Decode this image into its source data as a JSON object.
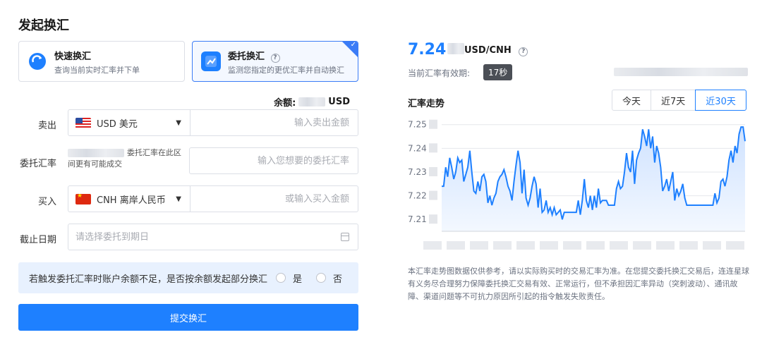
{
  "page": {
    "title": "发起换汇"
  },
  "modes": [
    {
      "title": "快速换汇",
      "desc": "查询当前实时汇率并下单",
      "icon": "quick-exchange-icon"
    },
    {
      "title": "委托换汇",
      "desc": "监测您指定的更优汇率并自动换汇",
      "icon": "entrusted-exchange-icon"
    }
  ],
  "balance": {
    "label": "余额:",
    "currency": "USD"
  },
  "form": {
    "sell": {
      "label": "卖出",
      "currency": "USD 美元",
      "placeholder": "输入卖出金额"
    },
    "rate": {
      "label": "委托汇率",
      "hint": "委托汇率在此区间更有可能成交",
      "placeholder": "输入您想要的委托汇率"
    },
    "buy": {
      "label": "买入",
      "currency": "CNH 离岸人民币",
      "placeholder": "或输入买入金额"
    },
    "deadline": {
      "label": "截止日期",
      "placeholder": "请选择委托到期日"
    },
    "partial": {
      "question": "若触发委托汇率时账户余额不足，是否按余额发起部分换汇",
      "yes": "是",
      "no": "否"
    },
    "submit": "提交换汇"
  },
  "quote": {
    "rate": "7.24",
    "pair": "USD/CNH",
    "valid_label": "当前汇率有效期:",
    "timer": "17秒"
  },
  "trend": {
    "title": "汇率走势",
    "tabs": [
      "今天",
      "近7天",
      "近30天"
    ],
    "active_tab": "近30天"
  },
  "chart_data": {
    "type": "area",
    "title": "汇率走势",
    "ylim": [
      7.205,
      7.252
    ],
    "yticks": [
      "7.25",
      "7.24",
      "7.23",
      "7.22",
      "7.21"
    ],
    "grid": true,
    "values": [
      7.224,
      7.224,
      7.232,
      7.228,
      7.236,
      7.232,
      7.227,
      7.23,
      7.236,
      7.234,
      7.235,
      7.226,
      7.229,
      7.232,
      7.239,
      7.23,
      7.222,
      7.221,
      7.226,
      7.222,
      7.228,
      7.229,
      7.226,
      7.217,
      7.22,
      7.216,
      7.219,
      7.221,
      7.226,
      7.228,
      7.229,
      7.231,
      7.228,
      7.224,
      7.222,
      7.218,
      7.226,
      7.233,
      7.239,
      7.234,
      7.221,
      7.231,
      7.219,
      7.216,
      7.219,
      7.224,
      7.228,
      7.225,
      7.215,
      7.223,
      7.213,
      7.214,
      7.218,
      7.213,
      7.215,
      7.212,
      7.215,
      7.212,
      7.213,
      7.214,
      7.21,
      7.213,
      7.213,
      7.213,
      7.213,
      7.213,
      7.213,
      7.213,
      7.218,
      7.212,
      7.218,
      7.227,
      7.218,
      7.215,
      7.22,
      7.214,
      7.22,
      7.215,
      7.223,
      7.217,
      7.218,
      7.218,
      7.218,
      7.216,
      7.216,
      7.216,
      7.216,
      7.223,
      7.226,
      7.223,
      7.224,
      7.23,
      7.238,
      7.232,
      7.23,
      7.239,
      7.225,
      7.235,
      7.238,
      7.24,
      7.248,
      7.245,
      7.241,
      7.248,
      7.24,
      7.245,
      7.234,
      7.241,
      7.238,
      7.232,
      7.222,
      7.224,
      7.227,
      7.222,
      7.226,
      7.23,
      7.218,
      7.223,
      7.22,
      7.222,
      7.225,
      7.219,
      7.216,
      7.216,
      7.216,
      7.216,
      7.216,
      7.216,
      7.216,
      7.216,
      7.216,
      7.216,
      7.216,
      7.216,
      7.216,
      7.216,
      7.221,
      7.217,
      7.219,
      7.226,
      7.227,
      7.224,
      7.228,
      7.235,
      7.239,
      7.234,
      7.241,
      7.238,
      7.246,
      7.249,
      7.249,
      7.243
    ],
    "colors": {
      "line": "#1e80ff",
      "fill_top": "#cfe2ff",
      "fill_bottom": "#f3f8ff"
    }
  },
  "disclaimer": "本汇率走势图数据仅供参考，请以实际购买时的交易汇率为准。在您提交委托换汇交易后，连连星球有义务尽合理努力保障委托换汇交易有效、正常运行，但不承担因汇率异动（突刺波动）、通讯故障、渠道问题等不可抗力原因所引起的指令触发失败责任。",
  "colors": {
    "accent": "#1e80ff",
    "tint": "#e8f1fe"
  }
}
